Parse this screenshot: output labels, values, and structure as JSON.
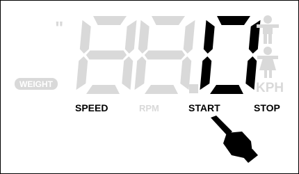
{
  "display": {
    "digits": [
      "8",
      "8",
      "0"
    ],
    "digit_states": [
      "inactive",
      "inactive",
      "active"
    ],
    "decimal_point": "."
  },
  "labels": {
    "quote_mark": "\"",
    "weight_badge": "WEIGHT",
    "unit": "KPH",
    "speed": "SPEED",
    "rpm": "RPM",
    "start": "START",
    "stop": "STOP"
  },
  "colors": {
    "active": "#000000",
    "inactive": "#d9d9d9",
    "background": "#ffffff"
  },
  "icons": {
    "male_figure": "person-male-icon",
    "female_figure": "person-female-icon",
    "pointer": "pointing-hand-icon"
  }
}
